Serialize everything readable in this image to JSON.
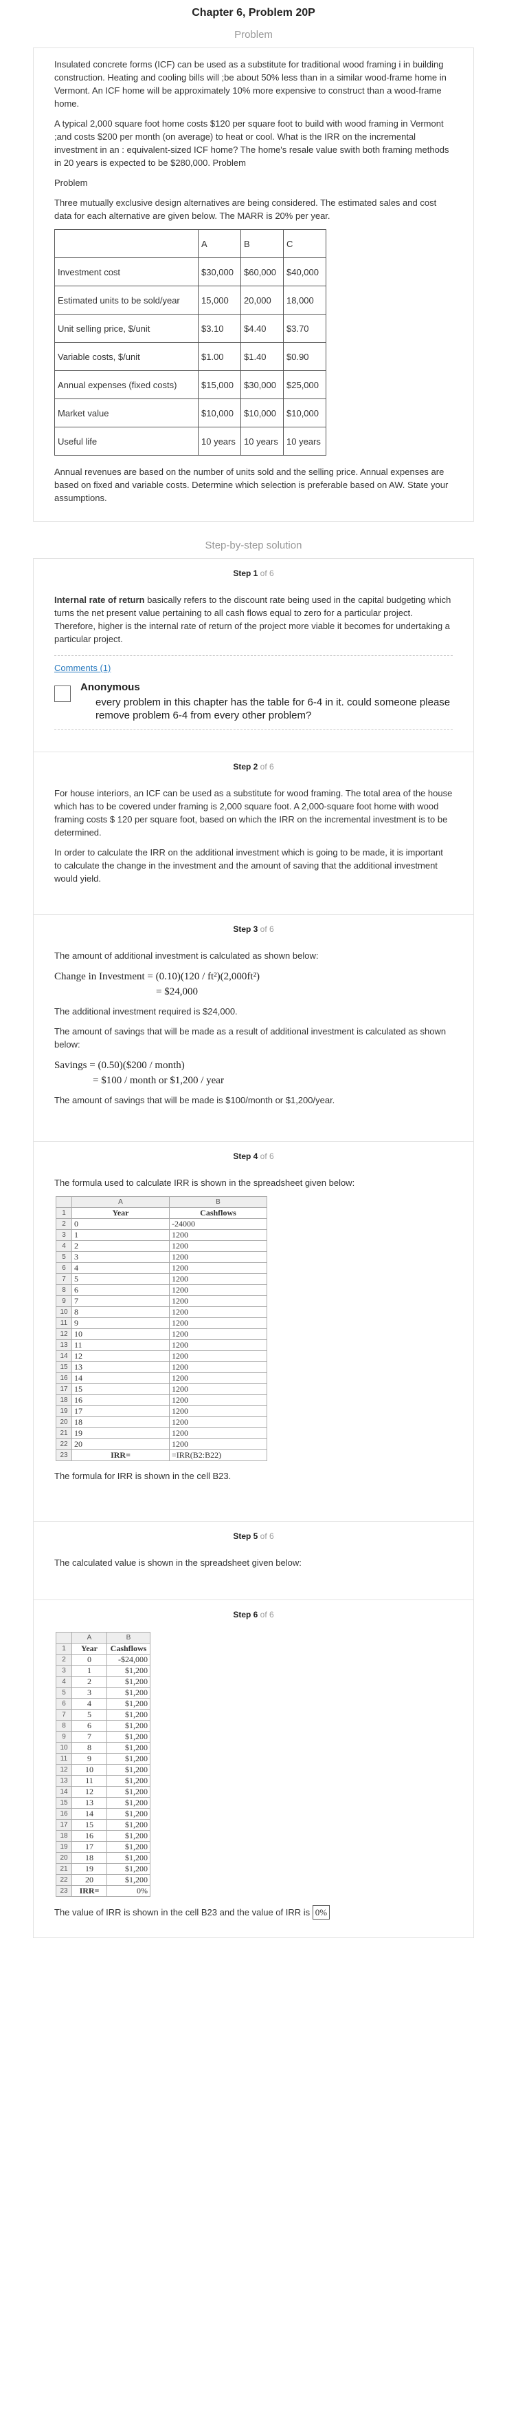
{
  "page_title": "Chapter 6, Problem 20P",
  "problem_heading": "Problem",
  "problem": {
    "p1": "Insulated concrete forms (ICF) can be used as a substitute for traditional wood framing i in building construction. Heating and cooling bills will ;be about 50% less than in a similar wood-frame home in Vermont. An ICF home will be approximately 10% more expensive to construct than a wood-frame home.",
    "p2": "A typical 2,000 square foot home costs $120 per square foot to build with wood framing in Vermont ;and costs $200 per month (on average) to heat or cool. What is the IRR on the incremental investment in an : equivalent-sized ICF home? The home's resale value swith both framing methods in 20 years is expected to be $280,000. Problem",
    "p3": "Problem",
    "p4": "Three mutually exclusive design alternatives are being considered. The estimated sales and cost data for each alternative are given below. The MARR is 20% per year.",
    "table_headers": [
      "",
      "A",
      "B",
      "C"
    ],
    "table_rows": [
      [
        "Investment cost",
        "$30,000",
        "$60,000",
        "$40,000"
      ],
      [
        "Estimated units to be sold/year",
        "15,000",
        "20,000",
        "18,000"
      ],
      [
        "Unit selling price, $/unit",
        "$3.10",
        "$4.40",
        "$3.70"
      ],
      [
        "Variable costs, $/unit",
        "$1.00",
        "$1.40",
        "$0.90"
      ],
      [
        "Annual expenses (fixed costs)",
        "$15,000",
        "$30,000",
        "$25,000"
      ],
      [
        "Market value",
        "$10,000",
        "$10,000",
        "$10,000"
      ],
      [
        "Useful life",
        "10 years",
        "10 years",
        "10 years"
      ]
    ],
    "p5": "Annual revenues are based on the number of units sold and the selling price. Annual expenses are based on fixed and variable costs. Determine which selection is preferable based on AW. State your assumptions."
  },
  "solution_heading": "Step-by-step solution",
  "steps": {
    "s1": {
      "label": "Step 1",
      "of": "of 6",
      "bold": "Internal rate of return",
      "text": " basically refers to the discount rate being used in the capital budgeting which turns the net present value pertaining to all cash flows equal to zero for a particular project. Therefore, higher is the internal rate of return of the project more viable it becomes for undertaking a particular project.",
      "comments_link": "Comments (1)",
      "comment_author": "Anonymous",
      "comment_text": "every problem in this chapter has the table for 6-4 in it. could someone please remove problem 6-4 from every other problem?"
    },
    "s2": {
      "label": "Step 2",
      "of": "of 6",
      "p1": "For house interiors, an ICF can be used as a substitute for wood framing. The total area of the house which has to be covered under framing is 2,000 square foot. A 2,000-square foot home with wood framing costs $ 120 per square foot, based on which the IRR on the incremental investment is to be determined.",
      "p2": "In order to calculate the IRR on the additional investment which is going to be made, it is important to calculate the change in the investment and the amount of saving that the additional investment would yield."
    },
    "s3": {
      "label": "Step 3",
      "of": "of 6",
      "p1": "The amount of additional investment is calculated as shown below:",
      "f1a": "Change in Investment = (0.10)(120 / ft²)(2,000ft²)",
      "f1b": "= $24,000",
      "p2": "The additional investment required is $24,000.",
      "p3": "The amount of savings that will be made as a result of additional investment is calculated as shown below:",
      "f2a": "Savings = (0.50)($200 / month)",
      "f2b": "= $100 / month or $1,200 / year",
      "p4": "The amount of savings that will be made is $100/month or $1,200/year."
    },
    "s4": {
      "label": "Step 4",
      "of": "of 6",
      "p1": "The formula used to calculate IRR is shown in the spreadsheet given below:",
      "col_a": "A",
      "col_b": "B",
      "h_year": "Year",
      "h_cash": "Cashflows",
      "rows": [
        [
          "0",
          "-24000"
        ],
        [
          "1",
          "1200"
        ],
        [
          "2",
          "1200"
        ],
        [
          "3",
          "1200"
        ],
        [
          "4",
          "1200"
        ],
        [
          "5",
          "1200"
        ],
        [
          "6",
          "1200"
        ],
        [
          "7",
          "1200"
        ],
        [
          "8",
          "1200"
        ],
        [
          "9",
          "1200"
        ],
        [
          "10",
          "1200"
        ],
        [
          "11",
          "1200"
        ],
        [
          "12",
          "1200"
        ],
        [
          "13",
          "1200"
        ],
        [
          "14",
          "1200"
        ],
        [
          "15",
          "1200"
        ],
        [
          "16",
          "1200"
        ],
        [
          "17",
          "1200"
        ],
        [
          "18",
          "1200"
        ],
        [
          "19",
          "1200"
        ],
        [
          "20",
          "1200"
        ]
      ],
      "irr_label": "IRR=",
      "irr_value": "=IRR(B2:B22)",
      "p2": "The formula for IRR is shown in the cell B23."
    },
    "s5": {
      "label": "Step 5",
      "of": "of 6",
      "p1": "The calculated value is shown in the spreadsheet given below:"
    },
    "s6": {
      "label": "Step 6",
      "of": "of 6",
      "col_a": "A",
      "col_b": "B",
      "h_year": "Year",
      "h_cash": "Cashflows",
      "rows": [
        [
          "0",
          "-$24,000"
        ],
        [
          "1",
          "$1,200"
        ],
        [
          "2",
          "$1,200"
        ],
        [
          "3",
          "$1,200"
        ],
        [
          "4",
          "$1,200"
        ],
        [
          "5",
          "$1,200"
        ],
        [
          "6",
          "$1,200"
        ],
        [
          "7",
          "$1,200"
        ],
        [
          "8",
          "$1,200"
        ],
        [
          "9",
          "$1,200"
        ],
        [
          "10",
          "$1,200"
        ],
        [
          "11",
          "$1,200"
        ],
        [
          "12",
          "$1,200"
        ],
        [
          "13",
          "$1,200"
        ],
        [
          "14",
          "$1,200"
        ],
        [
          "15",
          "$1,200"
        ],
        [
          "16",
          "$1,200"
        ],
        [
          "17",
          "$1,200"
        ],
        [
          "18",
          "$1,200"
        ],
        [
          "19",
          "$1,200"
        ],
        [
          "20",
          "$1,200"
        ]
      ],
      "irr_label": "IRR=",
      "irr_value": "0%",
      "p1": "The value of IRR is shown in the cell B23 and the value of IRR is",
      "p1_value": "0%"
    }
  }
}
